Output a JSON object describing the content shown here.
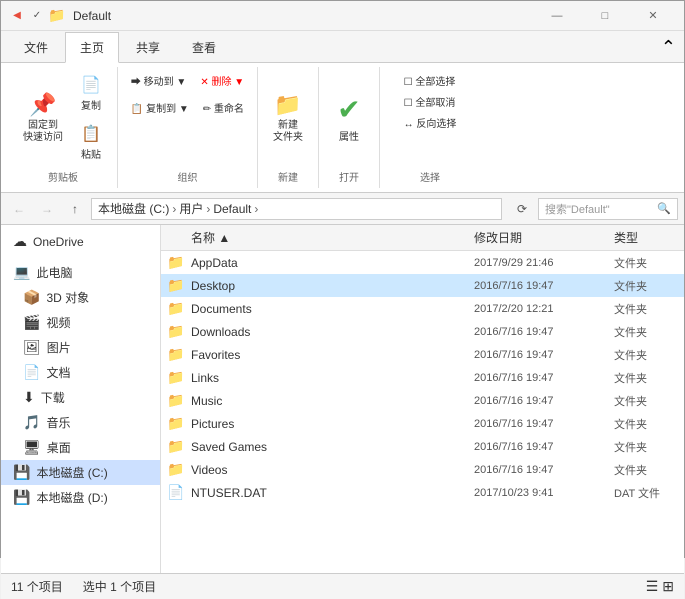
{
  "titleBar": {
    "title": "Default",
    "icons": [
      "📋",
      "💾",
      "📁"
    ],
    "controls": [
      "—",
      "□",
      "✕"
    ]
  },
  "menuTabs": [
    "文件",
    "主页",
    "共享",
    "查看"
  ],
  "activeTab": "主页",
  "ribbon": {
    "groups": [
      {
        "label": "剪贴板",
        "buttons": [
          {
            "id": "pin",
            "icon": "📌",
            "label": "固定到\n快速访问"
          },
          {
            "id": "copy",
            "icon": "📄",
            "label": "复制"
          },
          {
            "id": "paste",
            "icon": "📋",
            "label": "粘贴"
          }
        ]
      },
      {
        "label": "组织",
        "buttons": [
          {
            "id": "move-to",
            "icon": "➡",
            "label": "移动到▼"
          },
          {
            "id": "copy-to",
            "icon": "📋",
            "label": "复制到▼"
          },
          {
            "id": "delete",
            "icon": "✕",
            "label": "删除▼"
          },
          {
            "id": "rename",
            "icon": "✏",
            "label": "重命名"
          }
        ]
      },
      {
        "label": "新建",
        "buttons": [
          {
            "id": "new-folder",
            "icon": "📁",
            "label": "新建\n文件夹"
          }
        ]
      },
      {
        "label": "打开",
        "buttons": [
          {
            "id": "properties",
            "icon": "✔",
            "label": "属性"
          }
        ]
      },
      {
        "label": "选择",
        "buttons": [
          {
            "id": "select-all",
            "label": "全部选择"
          },
          {
            "id": "deselect-all",
            "label": "全部取消"
          },
          {
            "id": "invert",
            "label": "反向选择"
          }
        ]
      }
    ]
  },
  "addressBar": {
    "back": "←",
    "forward": "→",
    "up": "↑",
    "path": [
      "本地磁盘 (C:)",
      "用户",
      "Default"
    ],
    "refresh": "🔄",
    "searchPlaceholder": "搜索\"Default\"",
    "searchIcon": "🔍"
  },
  "sidebar": {
    "items": [
      {
        "id": "onedrive",
        "icon": "☁",
        "label": "OneDrive"
      },
      {
        "id": "this-pc",
        "icon": "💻",
        "label": "此电脑"
      },
      {
        "id": "3d-objects",
        "icon": "📦",
        "label": "3D 对象"
      },
      {
        "id": "videos",
        "icon": "🎬",
        "label": "视频"
      },
      {
        "id": "pictures",
        "icon": "🖼",
        "label": "图片"
      },
      {
        "id": "documents",
        "icon": "📄",
        "label": "文档"
      },
      {
        "id": "downloads",
        "icon": "⬇",
        "label": "下载"
      },
      {
        "id": "music",
        "icon": "🎵",
        "label": "音乐"
      },
      {
        "id": "desktop",
        "icon": "🖥",
        "label": "桌面"
      },
      {
        "id": "local-c",
        "icon": "💾",
        "label": "本地磁盘 (C:)",
        "selected": true
      },
      {
        "id": "local-d",
        "icon": "💾",
        "label": "本地磁盘 (D:)"
      }
    ]
  },
  "fileList": {
    "headers": [
      "名称",
      "修改日期",
      "类型"
    ],
    "files": [
      {
        "name": "AppData",
        "date": "2017/9/29 21:46",
        "type": "文件夹",
        "icon": "📁",
        "selected": false
      },
      {
        "name": "Desktop",
        "date": "2016/7/16 19:47",
        "type": "文件夹",
        "icon": "📁",
        "selected": true
      },
      {
        "name": "Documents",
        "date": "2017/2/20 12:21",
        "type": "文件夹",
        "icon": "📁",
        "selected": false
      },
      {
        "name": "Downloads",
        "date": "2016/7/16 19:47",
        "type": "文件夹",
        "icon": "📁",
        "selected": false
      },
      {
        "name": "Favorites",
        "date": "2016/7/16 19:47",
        "type": "文件夹",
        "icon": "📁",
        "selected": false
      },
      {
        "name": "Links",
        "date": "2016/7/16 19:47",
        "type": "文件夹",
        "icon": "📁",
        "selected": false
      },
      {
        "name": "Music",
        "date": "2016/7/16 19:47",
        "type": "文件夹",
        "icon": "📁",
        "selected": false
      },
      {
        "name": "Pictures",
        "date": "2016/7/16 19:47",
        "type": "文件夹",
        "icon": "📁",
        "selected": false
      },
      {
        "name": "Saved Games",
        "date": "2016/7/16 19:47",
        "type": "文件夹",
        "icon": "📁",
        "selected": false
      },
      {
        "name": "Videos",
        "date": "2016/7/16 19:47",
        "type": "文件夹",
        "icon": "📁",
        "selected": false
      },
      {
        "name": "NTUSER.DAT",
        "date": "2017/10/23 9:41",
        "type": "DAT 文件",
        "icon": "📄",
        "selected": false
      }
    ]
  },
  "statusBar": {
    "itemCount": "11 个项目",
    "selectedCount": "选中 1 个项目"
  }
}
